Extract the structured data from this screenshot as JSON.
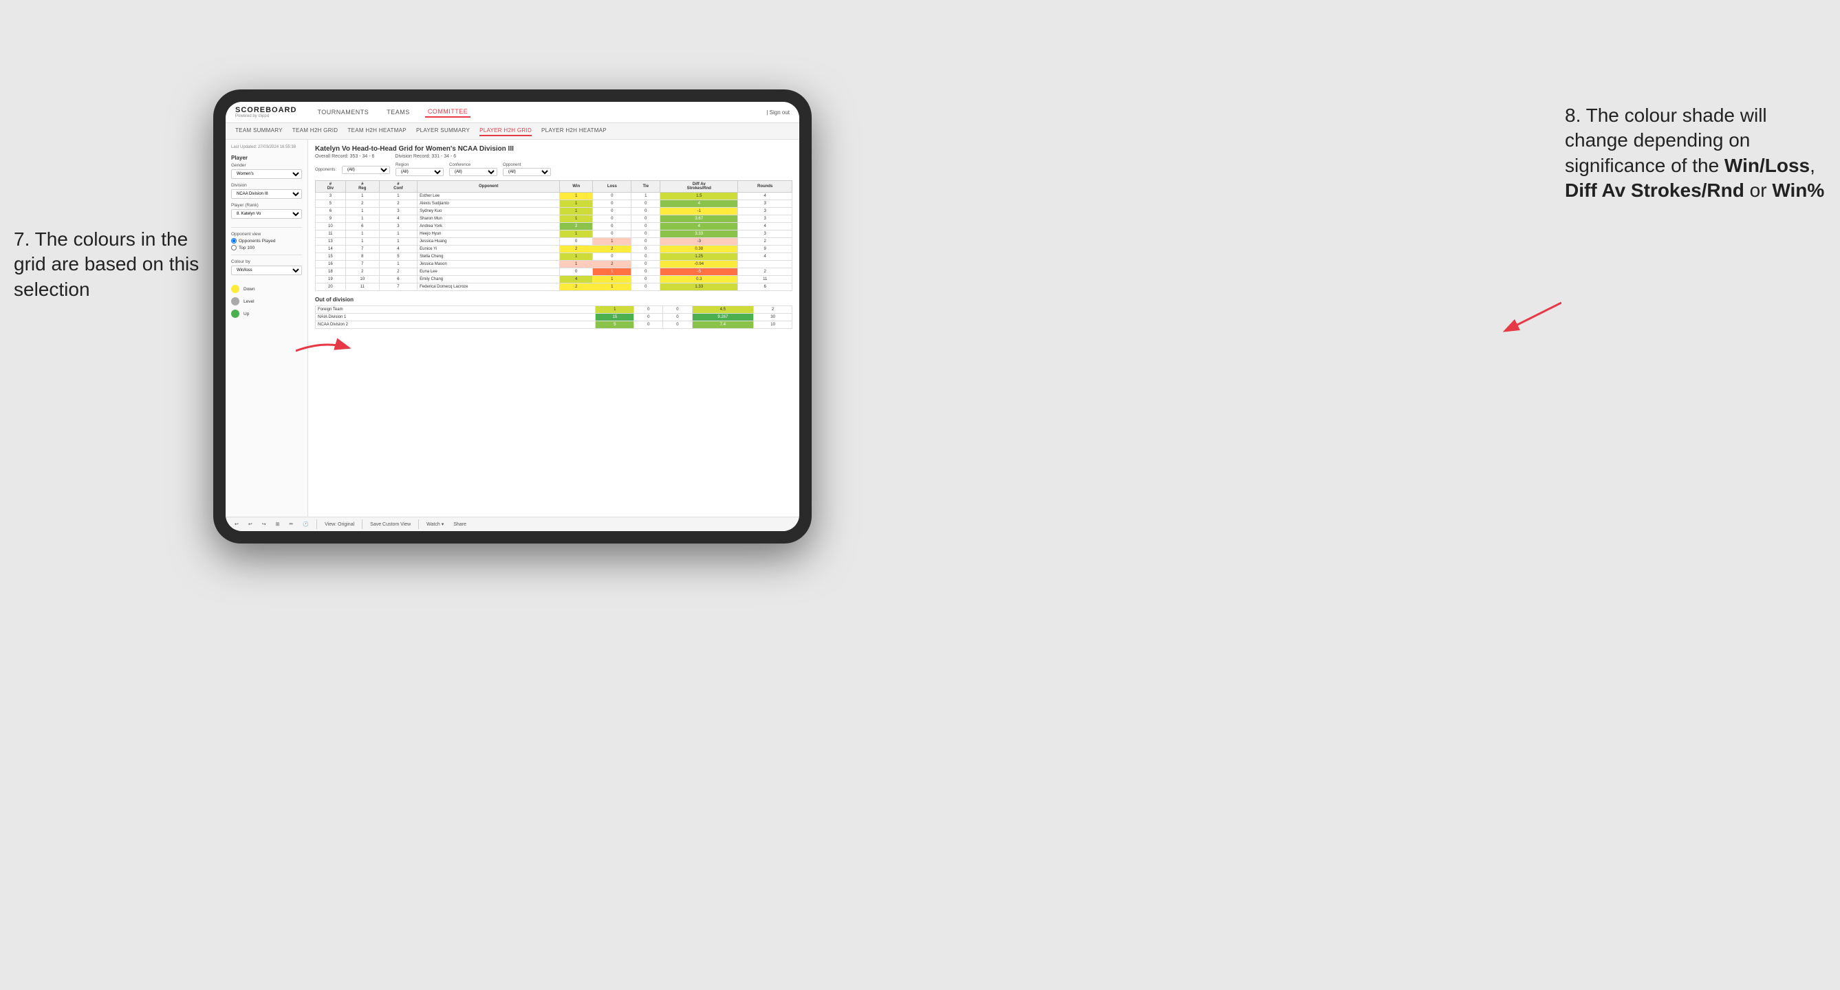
{
  "app": {
    "logo": "SCOREBOARD",
    "logo_sub": "Powered by clippd",
    "nav_items": [
      "TOURNAMENTS",
      "TEAMS",
      "COMMITTEE"
    ],
    "nav_active": "COMMITTEE",
    "nav_right_sign_in": "| Sign out"
  },
  "second_nav": {
    "items": [
      "TEAM SUMMARY",
      "TEAM H2H GRID",
      "TEAM H2H HEATMAP",
      "PLAYER SUMMARY",
      "PLAYER H2H GRID",
      "PLAYER H2H HEATMAP"
    ],
    "active": "PLAYER H2H GRID"
  },
  "sidebar": {
    "timestamp": "Last Updated: 27/03/2024 16:55:38",
    "section_player": "Player",
    "gender_label": "Gender",
    "gender_value": "Women's",
    "division_label": "Division",
    "division_value": "NCAA Division III",
    "player_rank_label": "Player (Rank)",
    "player_rank_value": "8. Katelyn Vo",
    "opponent_view_label": "Opponent view",
    "opponent_opponents_played": "Opponents Played",
    "opponent_top100": "Top 100",
    "colour_by_label": "Colour by",
    "colour_by_value": "Win/loss",
    "legend_down": "Down",
    "legend_level": "Level",
    "legend_up": "Up"
  },
  "grid": {
    "title": "Katelyn Vo Head-to-Head Grid for Women's NCAA Division III",
    "overall_record_label": "Overall Record:",
    "overall_record": "353 - 34 - 6",
    "division_record_label": "Division Record:",
    "division_record": "331 - 34 - 6",
    "filters": {
      "opponents_label": "Opponents:",
      "opponents_value": "(All)",
      "region_label": "Region",
      "region_value": "(All)",
      "conference_label": "Conference",
      "conference_value": "(All)",
      "opponent_label": "Opponent",
      "opponent_value": "(All)"
    },
    "table_headers": [
      "#\nDiv",
      "#\nReg",
      "#\nConf",
      "Opponent",
      "Win",
      "Loss",
      "Tie",
      "Diff Av\nStrokes/Rnd",
      "Rounds"
    ],
    "rows": [
      {
        "div": 3,
        "reg": 1,
        "conf": 1,
        "opponent": "Esther Lee",
        "win": 1,
        "loss": 0,
        "tie": 1,
        "diff": 1.5,
        "rounds": 4,
        "win_color": "yellow",
        "loss_color": "neutral",
        "tie_color": "neutral",
        "diff_color": "green-light"
      },
      {
        "div": 5,
        "reg": 2,
        "conf": 2,
        "opponent": "Alexis Sudjianto",
        "win": 1,
        "loss": 0,
        "tie": 0,
        "diff": 4.0,
        "rounds": 3,
        "win_color": "green-light",
        "loss_color": "neutral",
        "tie_color": "neutral",
        "diff_color": "green-med"
      },
      {
        "div": 6,
        "reg": 1,
        "conf": 3,
        "opponent": "Sydney Kuo",
        "win": 1,
        "loss": 0,
        "tie": 0,
        "diff": -1.0,
        "rounds": 3,
        "win_color": "green-light",
        "loss_color": "neutral",
        "tie_color": "neutral",
        "diff_color": "yellow"
      },
      {
        "div": 9,
        "reg": 1,
        "conf": 4,
        "opponent": "Sharon Mun",
        "win": 1,
        "loss": 0,
        "tie": 0,
        "diff": 3.67,
        "rounds": 3,
        "win_color": "green-light",
        "loss_color": "neutral",
        "tie_color": "neutral",
        "diff_color": "green-med"
      },
      {
        "div": 10,
        "reg": 6,
        "conf": 3,
        "opponent": "Andrea York",
        "win": 2,
        "loss": 0,
        "tie": 0,
        "diff": 4.0,
        "rounds": 4,
        "win_color": "green-med",
        "loss_color": "neutral",
        "tie_color": "neutral",
        "diff_color": "green-med"
      },
      {
        "div": 11,
        "reg": 1,
        "conf": 1,
        "opponent": "Heejo Hyun",
        "win": 1,
        "loss": 0,
        "tie": 0,
        "diff": 3.33,
        "rounds": 3,
        "win_color": "green-light",
        "loss_color": "neutral",
        "tie_color": "neutral",
        "diff_color": "green-med"
      },
      {
        "div": 13,
        "reg": 1,
        "conf": 1,
        "opponent": "Jessica Huang",
        "win": 0,
        "loss": 1,
        "tie": 0,
        "diff": -3.0,
        "rounds": 2,
        "win_color": "neutral",
        "loss_color": "red-light",
        "tie_color": "neutral",
        "diff_color": "red-light"
      },
      {
        "div": 14,
        "reg": 7,
        "conf": 4,
        "opponent": "Eunice Yi",
        "win": 2,
        "loss": 2,
        "tie": 0,
        "diff": 0.38,
        "rounds": 9,
        "win_color": "yellow",
        "loss_color": "yellow",
        "tie_color": "neutral",
        "diff_color": "yellow"
      },
      {
        "div": 15,
        "reg": 8,
        "conf": 5,
        "opponent": "Stella Cheng",
        "win": 1,
        "loss": 0,
        "tie": 0,
        "diff": 1.25,
        "rounds": 4,
        "win_color": "green-light",
        "loss_color": "neutral",
        "tie_color": "neutral",
        "diff_color": "green-light"
      },
      {
        "div": 16,
        "reg": 7,
        "conf": 1,
        "opponent": "Jessica Mason",
        "win": 1,
        "loss": 2,
        "tie": 0,
        "diff": -0.94,
        "rounds": "",
        "win_color": "red-light",
        "loss_color": "red-light",
        "tie_color": "neutral",
        "diff_color": "yellow"
      },
      {
        "div": 18,
        "reg": 2,
        "conf": 2,
        "opponent": "Euna Lee",
        "win": 0,
        "loss": 1,
        "tie": 0,
        "diff": -5.0,
        "rounds": 2,
        "win_color": "neutral",
        "loss_color": "red-med",
        "tie_color": "neutral",
        "diff_color": "red-med"
      },
      {
        "div": 19,
        "reg": 10,
        "conf": 6,
        "opponent": "Emily Chang",
        "win": 4,
        "loss": 1,
        "tie": 0,
        "diff": 0.3,
        "rounds": 11,
        "win_color": "green-light",
        "loss_color": "yellow",
        "tie_color": "neutral",
        "diff_color": "yellow"
      },
      {
        "div": 20,
        "reg": 11,
        "conf": 7,
        "opponent": "Federica Domecq Lacroze",
        "win": 2,
        "loss": 1,
        "tie": 0,
        "diff": 1.33,
        "rounds": 6,
        "win_color": "yellow",
        "loss_color": "yellow",
        "tie_color": "neutral",
        "diff_color": "green-light"
      }
    ],
    "out_of_division_title": "Out of division",
    "out_of_division_rows": [
      {
        "opponent": "Foreign Team",
        "win": 1,
        "loss": 0,
        "tie": 0,
        "diff": 4.5,
        "rounds": 2,
        "win_color": "green-light"
      },
      {
        "opponent": "NAIA Division 1",
        "win": 15,
        "loss": 0,
        "tie": 0,
        "diff": 9.267,
        "rounds": 30,
        "win_color": "green-dark"
      },
      {
        "opponent": "NCAA Division 2",
        "win": 5,
        "loss": 0,
        "tie": 0,
        "diff": 7.4,
        "rounds": 10,
        "win_color": "green-med"
      }
    ]
  },
  "toolbar": {
    "view_original": "View: Original",
    "save_custom": "Save Custom View",
    "watch": "Watch ▾",
    "share": "Share"
  },
  "annotations": {
    "left": "7. The colours in the grid are based on this selection",
    "right_prefix": "8. The colour shade will change depending on significance of the ",
    "right_bold1": "Win/Loss",
    "right_comma": ", ",
    "right_bold2": "Diff Av Strokes/Rnd",
    "right_or": " or ",
    "right_bold3": "Win%"
  }
}
